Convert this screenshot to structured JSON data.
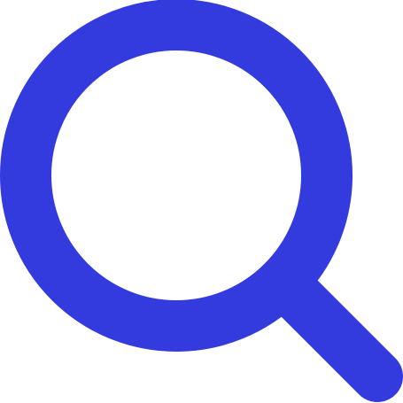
{
  "icon": {
    "name": "search-icon",
    "color": "#333BDF",
    "background": "#FFFFFF"
  }
}
